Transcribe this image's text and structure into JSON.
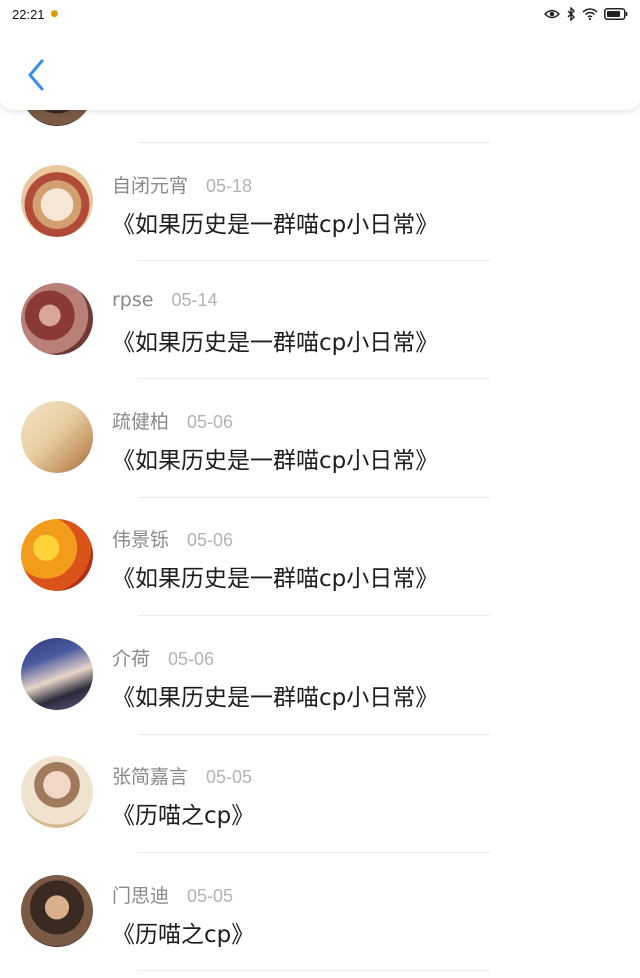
{
  "status_bar": {
    "time": "22:21",
    "icons": [
      "notification-dot-icon",
      "eye-icon",
      "bluetooth-icon",
      "wifi-icon",
      "battery-icon"
    ]
  },
  "header": {
    "back_icon": "chevron-left-icon",
    "accent_color": "#3a8ee6"
  },
  "comments": [
    {
      "name": "自闭元宵",
      "date": "05-18",
      "text": "《如果历史是一群喵cp小日常》"
    },
    {
      "name": "rpse",
      "date": "05-14",
      "text": "《如果历史是一群喵cp小日常》"
    },
    {
      "name": "疏健柏",
      "date": "05-06",
      "text": "《如果历史是一群喵cp小日常》"
    },
    {
      "name": "伟景铄",
      "date": "05-06",
      "text": "《如果历史是一群喵cp小日常》"
    },
    {
      "name": "介荷",
      "date": "05-06",
      "text": "《如果历史是一群喵cp小日常》"
    },
    {
      "name": "张简嘉言",
      "date": "05-05",
      "text": "《历喵之cp》"
    },
    {
      "name": "门思迪",
      "date": "05-05",
      "text": "《历喵之cp》"
    }
  ]
}
